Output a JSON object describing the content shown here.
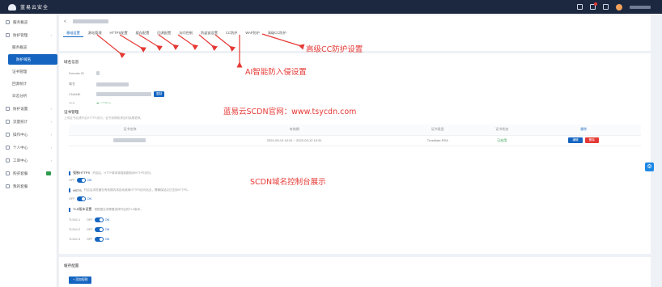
{
  "app": {
    "title": "蓝易云安全"
  },
  "sidebar": {
    "items": [
      {
        "label": "服务概览",
        "kind": "top"
      },
      {
        "label": "防护管理",
        "kind": "group"
      },
      {
        "label": "服务概览",
        "kind": "sub"
      },
      {
        "label": "防护域名",
        "kind": "active"
      },
      {
        "label": "证书管理",
        "kind": "sub"
      },
      {
        "label": "回源统计",
        "kind": "sub"
      },
      {
        "label": "日志分析",
        "kind": "sub"
      },
      {
        "label": "防护设置",
        "kind": "group"
      },
      {
        "label": "流量统计",
        "kind": "group"
      },
      {
        "label": "操作中心",
        "kind": "group"
      },
      {
        "label": "个人中心",
        "kind": "group"
      },
      {
        "label": "工单中心",
        "kind": "group"
      },
      {
        "label": "购买套餐",
        "kind": "group"
      },
      {
        "label": "我的套餐",
        "kind": "group"
      }
    ]
  },
  "header": {
    "back": "<",
    "tabs": [
      "基础设置",
      "源站管理",
      "HTTPS配置",
      "缓存配置",
      "回源配置",
      "访问控制",
      "防盗链设置",
      "CC防护",
      "WAF防护",
      "高级CC防护"
    ]
  },
  "basic": {
    "title": "域名信息",
    "rows": [
      {
        "label": "Domain ID"
      },
      {
        "label": "域名"
      },
      {
        "label": "CNAME",
        "button": "复制"
      },
      {
        "label": "状态",
        "status": "已开启"
      }
    ]
  },
  "ssl": {
    "title": "证书管理",
    "note": "上传证书后请开启HTTPS访问，证书到期前请及时续期更换。",
    "table": {
      "headers": [
        "证书名称",
        "有效期",
        "证书类型",
        "证书状态",
        "操作"
      ],
      "row": {
        "name": "",
        "period": "2021-09-13 10:31 ~ 2022-03-12 10:31",
        "type": "TrustAsia RSA",
        "status": "已启用",
        "edit": "编辑",
        "del": "删除"
      }
    },
    "sections": [
      {
        "title": "强制HTTPS",
        "desc": "开启后，HTTP请求将强制跳转到HTTPS访问。",
        "toggles": [
          {
            "label": "",
            "off": "OFF",
            "on": "ON"
          }
        ]
      },
      {
        "title": "HSTS",
        "desc": "开启后浏览器在有效期内将自动使用HTTPS访问站点，需确保站点已支持HTTPS。",
        "toggles": [
          {
            "label": "",
            "off": "OFF",
            "on": "ON"
          }
        ]
      },
      {
        "title": "TLS版本设置",
        "desc": "请根据业务需要选择开启的TLS版本。",
        "toggles": [
          {
            "label": "TLSv1.1",
            "off": "OFF",
            "on": "ON"
          },
          {
            "label": "TLSv1.2",
            "off": "OFF",
            "on": "ON"
          },
          {
            "label": "TLSv1.3",
            "off": "OFF",
            "on": "ON"
          }
        ]
      }
    ]
  },
  "cache": {
    "title": "缓存配置",
    "add": "+ 添加规则",
    "cols": [
      "序号",
      "规则",
      "操作"
    ]
  },
  "annotations": {
    "cc": "高级CC防护设置",
    "ai": "AI智能防入侵设置",
    "site": "蓝易云SCDN官网：www.tsycdn.com",
    "console": "SCDN域名控制台展示"
  },
  "colors": {
    "accent": "#1565c0",
    "annotation": "#e53935",
    "topbar": "#1c2840"
  }
}
